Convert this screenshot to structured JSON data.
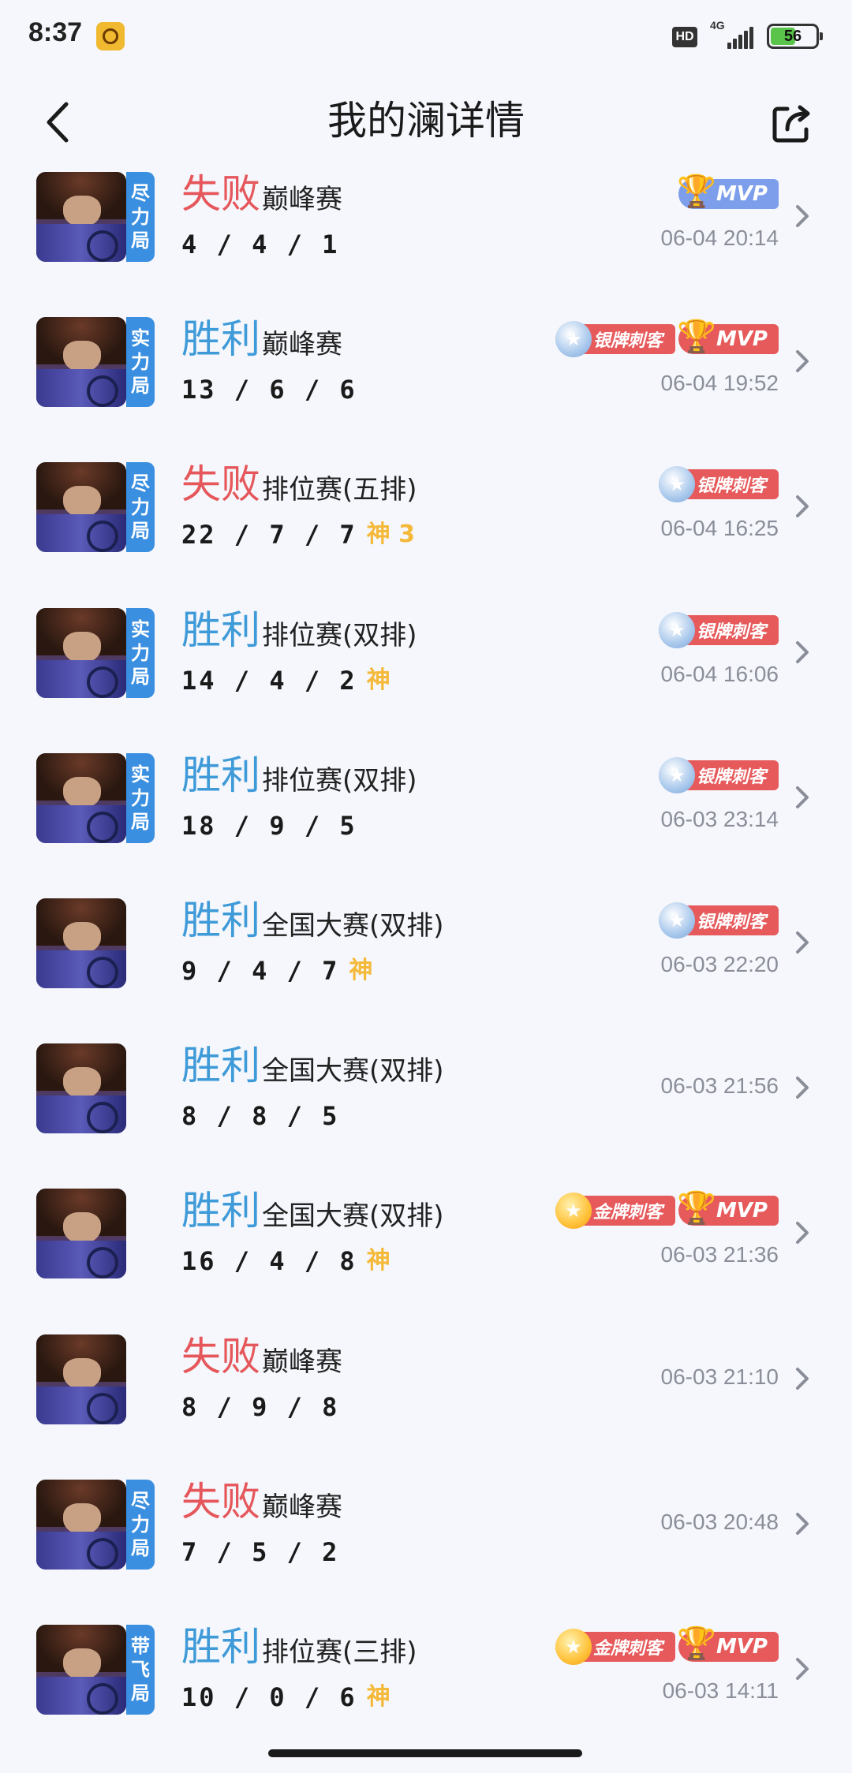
{
  "status": {
    "time": "8:37",
    "hd": "HD",
    "network": "4G",
    "battery": "56",
    "battery_level": 0.56
  },
  "header": {
    "title": "我的澜详情",
    "back_icon": "chevron-left-icon",
    "share_icon": "share-icon"
  },
  "matches": [
    {
      "result": "失败",
      "result_type": "lose",
      "mode": "巅峰赛",
      "tag": [
        "尽",
        "力",
        "局"
      ],
      "kda": "4 / 4 / 1",
      "god": "",
      "time": "06-04 20:14",
      "badges": [
        "mvp-blue"
      ]
    },
    {
      "result": "胜利",
      "result_type": "win",
      "mode": "巅峰赛",
      "tag": [
        "实",
        "力",
        "局"
      ],
      "kda": "13 / 6 / 6",
      "god": "",
      "time": "06-04 19:52",
      "badges": [
        "silver",
        "mvp"
      ]
    },
    {
      "result": "失败",
      "result_type": "lose",
      "mode": "排位赛(五排)",
      "tag": [
        "尽",
        "力",
        "局"
      ],
      "kda": "22 / 7 / 7",
      "god": "神 3",
      "time": "06-04 16:25",
      "badges": [
        "silver"
      ]
    },
    {
      "result": "胜利",
      "result_type": "win",
      "mode": "排位赛(双排)",
      "tag": [
        "实",
        "力",
        "局"
      ],
      "kda": "14 / 4 / 2",
      "god": "神",
      "time": "06-04 16:06",
      "badges": [
        "silver"
      ]
    },
    {
      "result": "胜利",
      "result_type": "win",
      "mode": "排位赛(双排)",
      "tag": [
        "实",
        "力",
        "局"
      ],
      "kda": "18 / 9 / 5",
      "god": "",
      "time": "06-03 23:14",
      "badges": [
        "silver"
      ]
    },
    {
      "result": "胜利",
      "result_type": "win",
      "mode": "全国大赛(双排)",
      "tag": [],
      "kda": "9 / 4 / 7",
      "god": "神",
      "time": "06-03 22:20",
      "badges": [
        "silver"
      ]
    },
    {
      "result": "胜利",
      "result_type": "win",
      "mode": "全国大赛(双排)",
      "tag": [],
      "kda": "8 / 8 / 5",
      "god": "",
      "time": "06-03 21:56",
      "badges": []
    },
    {
      "result": "胜利",
      "result_type": "win",
      "mode": "全国大赛(双排)",
      "tag": [],
      "kda": "16 / 4 / 8",
      "god": "神",
      "time": "06-03 21:36",
      "badges": [
        "gold",
        "mvp"
      ]
    },
    {
      "result": "失败",
      "result_type": "lose",
      "mode": "巅峰赛",
      "tag": [],
      "kda": "8 / 9 / 8",
      "god": "",
      "time": "06-03 21:10",
      "badges": []
    },
    {
      "result": "失败",
      "result_type": "lose",
      "mode": "巅峰赛",
      "tag": [
        "尽",
        "力",
        "局"
      ],
      "kda": "7 / 5 / 2",
      "god": "",
      "time": "06-03 20:48",
      "badges": []
    },
    {
      "result": "胜利",
      "result_type": "win",
      "mode": "排位赛(三排)",
      "tag": [
        "带",
        "飞",
        "局"
      ],
      "kda": "10 / 0 / 6",
      "god": "神",
      "time": "06-03 14:11",
      "badges": [
        "gold",
        "mvp"
      ]
    }
  ],
  "badge_labels": {
    "silver": "银牌刺客",
    "gold": "金牌刺客",
    "mvp": "MVP",
    "mvp-blue": "MVP"
  },
  "colors": {
    "win": "#3f9ad8",
    "lose": "#e5575b",
    "tag": "#3a8fe0",
    "god": "#f5b93a",
    "background": "#f5f7fc"
  }
}
